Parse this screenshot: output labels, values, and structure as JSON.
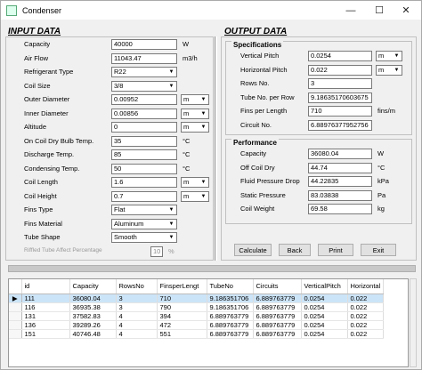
{
  "window": {
    "title": "Condenser"
  },
  "input_data": {
    "heading": "INPUT DATA",
    "rows": [
      {
        "label": "Capacity",
        "value": "40000",
        "unit": "W"
      },
      {
        "label": "Air Flow",
        "value": "11043.47",
        "unit": "m3/h"
      },
      {
        "label": "Refrigerant Type",
        "select": "R22"
      },
      {
        "label": "Coil Size",
        "select": "3/8"
      },
      {
        "label": "Outer Diameter",
        "value": "0.00952",
        "unit_select": "m"
      },
      {
        "label": "Inner Diameter",
        "value": "0.00856",
        "unit_select": "m"
      },
      {
        "label": "Altitude",
        "value": "0",
        "unit_select": "m"
      },
      {
        "label": "On Coil Dry Bulb Temp.",
        "value": "35",
        "unit": "°C"
      },
      {
        "label": "Discharge Temp.",
        "value": "85",
        "unit": "°C"
      },
      {
        "label": "Condensing Temp.",
        "value": "50",
        "unit": "°C"
      },
      {
        "label": "Coil Length",
        "value": "1.6",
        "unit_select": "m"
      },
      {
        "label": "Coil Height",
        "value": "0.7",
        "unit_select": "m"
      },
      {
        "label": "Fins Type",
        "select": "Flat"
      },
      {
        "label": "Fins Material",
        "select": "Aluminum"
      },
      {
        "label": "Tube Shape",
        "select": "Smooth"
      },
      {
        "label": "Riffled Tube Affect Percentage",
        "value": "10",
        "unit": "%"
      }
    ]
  },
  "output_data": {
    "heading": "OUTPUT DATA",
    "specifications": {
      "heading": "Specifications",
      "rows": [
        {
          "label": "Vertical Pitch",
          "value": "0.0254",
          "unit_select": "m"
        },
        {
          "label": "Horizontal Pitch",
          "value": "0.022",
          "unit_select": "m"
        },
        {
          "label": "Rows No.",
          "value": "3"
        },
        {
          "label": "Tube No. per Row",
          "value": "9.18635170603675"
        },
        {
          "label": "Fins per Length",
          "value": "710",
          "unit": "fins/m"
        },
        {
          "label": "Circuit No.",
          "value": "6.88976377952756"
        }
      ]
    },
    "performance": {
      "heading": "Performance",
      "rows": [
        {
          "label": "Capacity",
          "value": "36080.04",
          "unit": "W"
        },
        {
          "label": "Off Coil Dry",
          "value": "44.74",
          "unit": "°C"
        },
        {
          "label": "Fluid Pressure Drop",
          "value": "44.22835",
          "unit": "kPa"
        },
        {
          "label": "Static Pressure",
          "value": "83.03838",
          "unit": "Pa"
        },
        {
          "label": "Coil Weight",
          "value": "69.58",
          "unit": "kg"
        }
      ]
    }
  },
  "buttons": {
    "calculate": "Calculate",
    "back": "Back",
    "print": "Print",
    "exit": "Exit"
  },
  "grid": {
    "columns": [
      "id",
      "Capacity",
      "RowsNo",
      "FinsperLengt",
      "TubeNo",
      "Circuits",
      "VerticalPitch",
      "Horizontal"
    ],
    "rows": [
      [
        "111",
        "36080.04",
        "3",
        "710",
        "9.186351706",
        "6.889763779",
        "0.0254",
        "0.022"
      ],
      [
        "116",
        "36935.38",
        "3",
        "790",
        "9.186351706",
        "6.889763779",
        "0.0254",
        "0.022"
      ],
      [
        "131",
        "37582.83",
        "4",
        "394",
        "6.889763779",
        "6.889763779",
        "0.0254",
        "0.022"
      ],
      [
        "136",
        "39289.26",
        "4",
        "472",
        "6.889763779",
        "6.889763779",
        "0.0254",
        "0.022"
      ],
      [
        "151",
        "40746.48",
        "4",
        "551",
        "6.889763779",
        "6.889763779",
        "0.0254",
        "0.022"
      ]
    ],
    "selected_row": 0,
    "row_marker": "▶"
  }
}
